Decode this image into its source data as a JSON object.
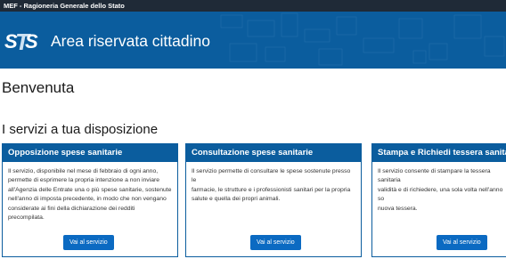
{
  "header": {
    "top_title": "MEF - Ragioneria Generale dello Stato",
    "app_title": "Area riservata cittadino",
    "logo_icon": "sts-logo"
  },
  "main": {
    "welcome": "Benvenuta",
    "services_title": "I servizi a tua disposizione"
  },
  "cards": [
    {
      "title": "Opposizione spese sanitarie",
      "lines": [
        "Il servizio, disponibile nel mese di febbraio di ogni anno,",
        "permette di esprimere la propria intenzione a non inviare",
        "all'Agenzia delle Entrate una o più spese sanitarie, sostenute",
        "nell'anno di imposta precedente, in modo che non vengano",
        "considerate ai fini della dichiarazione dei redditi",
        "precompilata."
      ],
      "button": "Vai al servizio"
    },
    {
      "title": "Consultazione spese sanitarie",
      "lines": [
        "Il servizio permette di consultare le spese sostenute presso le",
        "farmacie, le strutture e i professionisti sanitari per la propria",
        "salute e quella dei propri animali."
      ],
      "button": "Vai al servizio"
    },
    {
      "title": "Stampa e Richiedi tessera sanitaria",
      "lines": [
        "Il servizio consente di stampare la tessera sanitaria",
        "validità e di richiedere, una sola volta nell'anno so",
        "nuova tessera."
      ],
      "button": "Vai al servizio"
    }
  ],
  "colors": {
    "top_bar": "#1f2a37",
    "brand_blue": "#0b5d9e",
    "button_blue": "#0b6ac2"
  }
}
